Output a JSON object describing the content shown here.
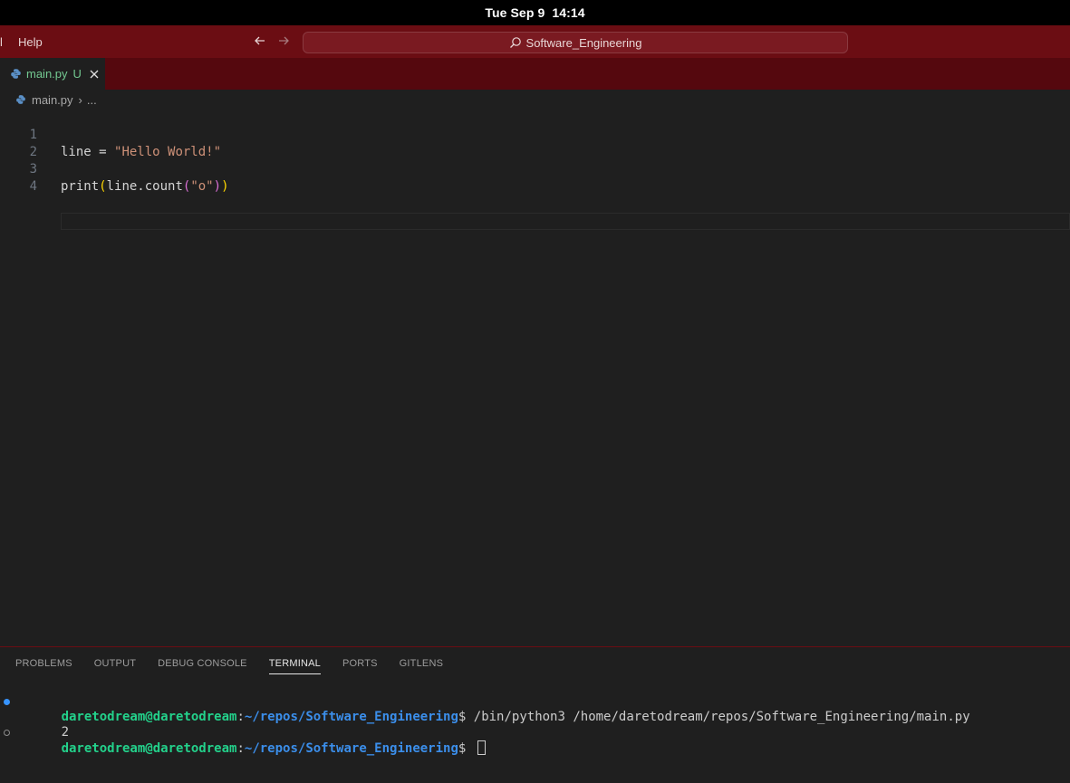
{
  "system_bar": {
    "clock": "Tue Sep 9  14:14"
  },
  "titlebar": {
    "menu_fragment": "l",
    "menu_help": "Help",
    "search_text": "Software_Engineering"
  },
  "tab": {
    "filename": "main.py",
    "status": "U"
  },
  "breadcrumb": {
    "file": "main.py",
    "more": "..."
  },
  "editor": {
    "lines": [
      {
        "number": "1",
        "var": "line",
        "op": " = ",
        "str": "\"Hello World!\""
      },
      {
        "number": "2"
      },
      {
        "number": "3",
        "fn": "print",
        "p1": "(",
        "obj": "line.count",
        "p2": "(",
        "arg": "\"o\"",
        "p3": ")",
        "p4": ")"
      },
      {
        "number": "4"
      }
    ]
  },
  "panel": {
    "tabs": [
      "PROBLEMS",
      "OUTPUT",
      "DEBUG CONSOLE",
      "TERMINAL",
      "PORTS",
      "GITLENS"
    ],
    "active_tab": "TERMINAL"
  },
  "terminal": {
    "user": "daretodream@daretodream",
    "colon": ":",
    "path": "~/repos/Software_Engineering",
    "prompt_end": "$ ",
    "command": "/bin/python3 /home/daretodream/repos/Software_Engineering/main.py",
    "output": "2"
  },
  "colors": {
    "titlebar": "#6b0d13",
    "tabstrip": "#55080e",
    "editor_bg": "#1f1f1f",
    "string": "#ce9178",
    "terminal_user": "#23d18b",
    "terminal_path": "#3b8eea"
  }
}
